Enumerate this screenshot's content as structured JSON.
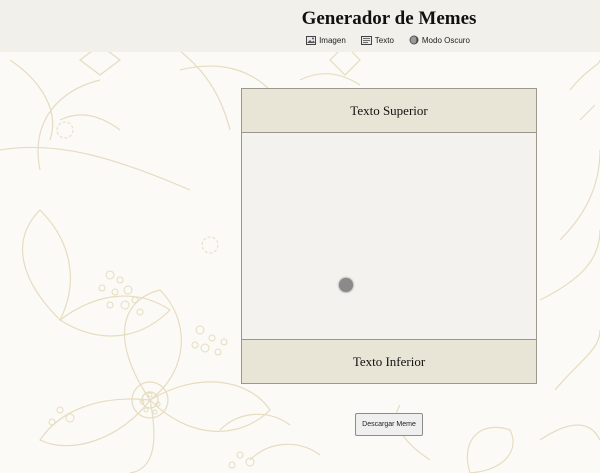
{
  "header": {
    "title": "Generador de Memes",
    "toolbar": [
      {
        "label": "Imagen",
        "icon": "image-icon"
      },
      {
        "label": "Texto",
        "icon": "text-icon"
      },
      {
        "label": "Modo Oscuro",
        "icon": "dark-mode-icon"
      }
    ]
  },
  "meme": {
    "top_text": "Texto Superior",
    "bottom_text": "Texto Inferior"
  },
  "actions": {
    "download_label": "Descargar Meme"
  },
  "colors": {
    "header_bg": "#f1f0eb",
    "page_bg": "#fbfaf6",
    "band_bg": "#e9e5d6",
    "floral_line": "#e6dcc0"
  }
}
